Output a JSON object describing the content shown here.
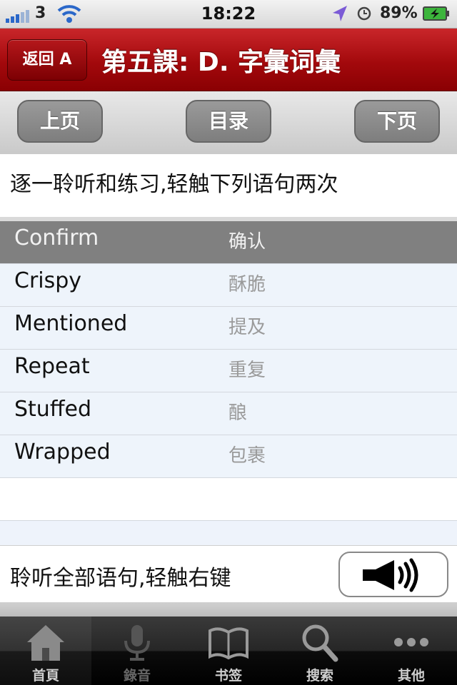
{
  "status_bar": {
    "carrier": "3",
    "time": "18:22",
    "battery": "89%"
  },
  "navbar": {
    "back_label": "返回 A",
    "title": "第五課: D. 字彙词彙"
  },
  "toolbar": {
    "prev_label": "上页",
    "toc_label": "目录",
    "next_label": "下页"
  },
  "instruction": "逐一聆听和练习,轻触下列语句两次",
  "words": [
    {
      "en": "Confirm",
      "zh": "确认",
      "selected": true
    },
    {
      "en": "Crispy",
      "zh": "酥脆"
    },
    {
      "en": "Mentioned",
      "zh": "提及"
    },
    {
      "en": "Repeat",
      "zh": "重复"
    },
    {
      "en": "Stuffed",
      "zh": "酿"
    },
    {
      "en": "Wrapped",
      "zh": "包裹"
    }
  ],
  "listen_all": {
    "text": "聆听全部语句,轻触右键"
  },
  "tabs": [
    {
      "label": "首頁",
      "icon": "home-icon"
    },
    {
      "label": "錄音",
      "icon": "microphone-icon"
    },
    {
      "label": "书签",
      "icon": "book-icon"
    },
    {
      "label": "搜索",
      "icon": "search-icon"
    },
    {
      "label": "其他",
      "icon": "more-icon"
    }
  ],
  "colors": {
    "nav_red": "#a3090c",
    "selected_row": "#808080",
    "row_bg": "#eef4fb"
  }
}
